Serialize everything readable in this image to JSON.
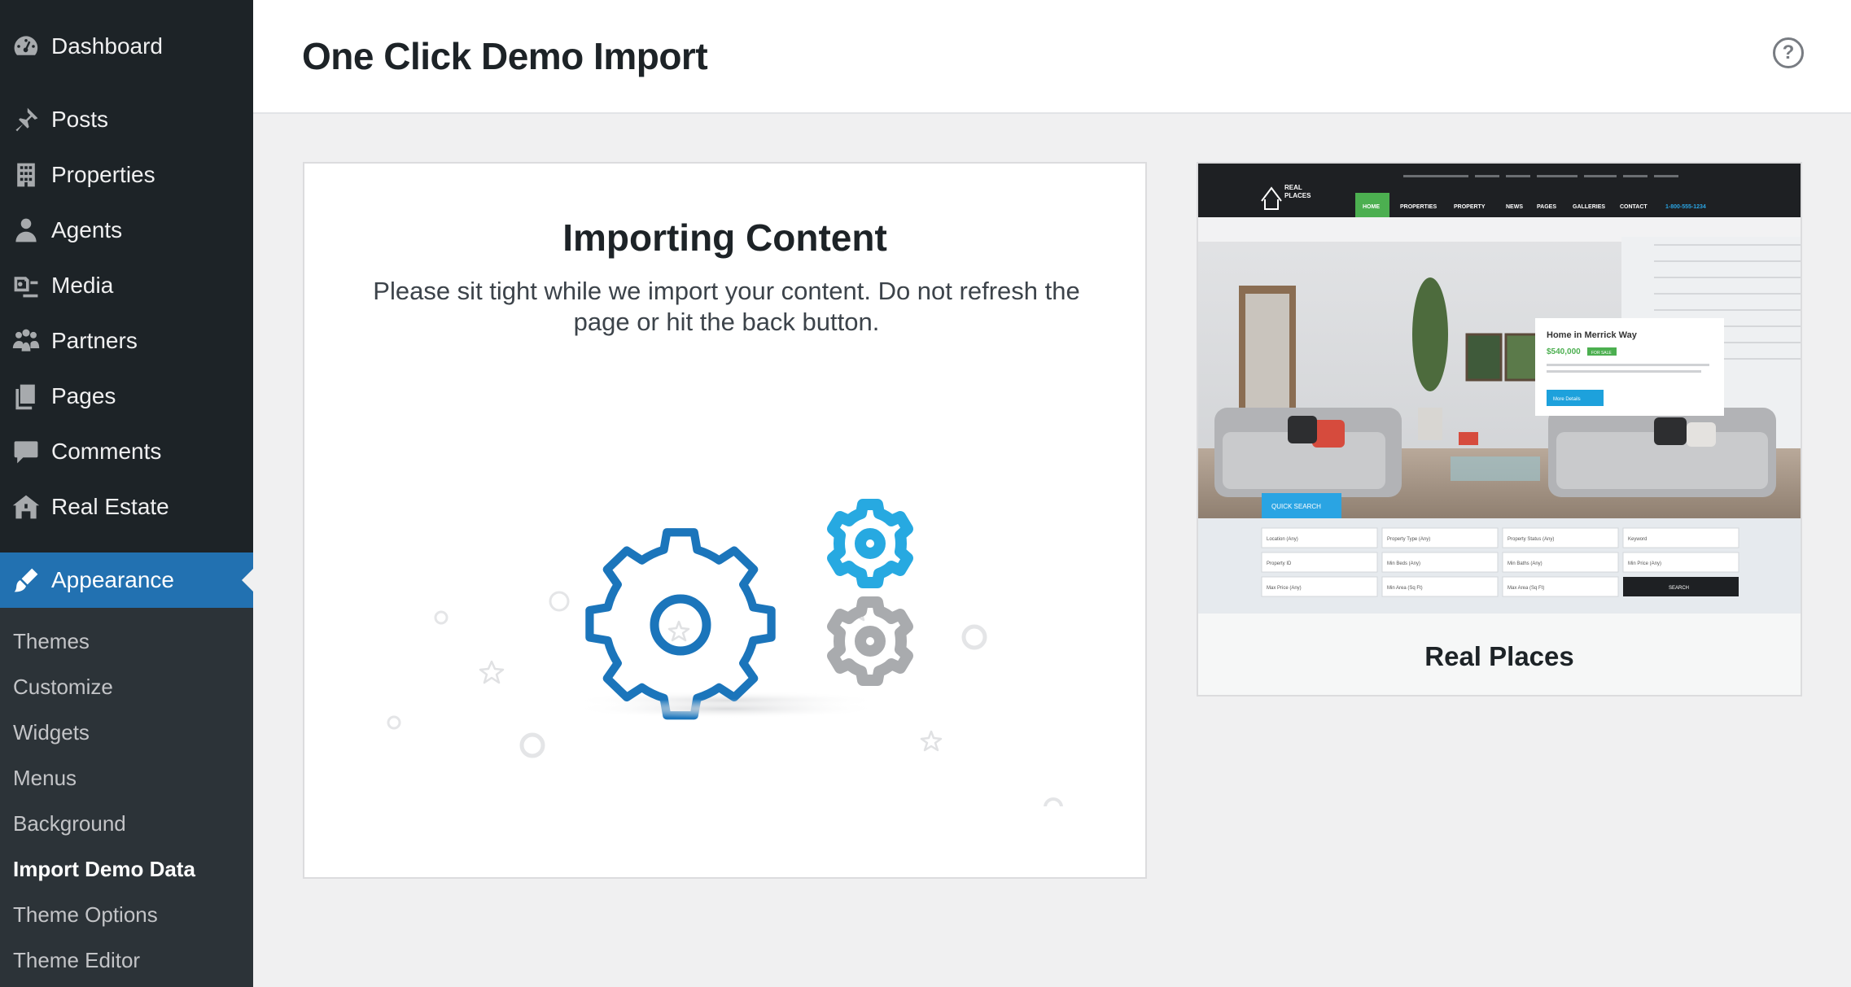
{
  "sidebar": {
    "items": [
      {
        "label": "Dashboard",
        "icon": "dashboard-icon"
      },
      {
        "label": "Posts",
        "icon": "pin-icon"
      },
      {
        "label": "Properties",
        "icon": "building-icon"
      },
      {
        "label": "Agents",
        "icon": "user-icon"
      },
      {
        "label": "Media",
        "icon": "media-icon"
      },
      {
        "label": "Partners",
        "icon": "groups-icon"
      },
      {
        "label": "Pages",
        "icon": "pages-icon"
      },
      {
        "label": "Comments",
        "icon": "comment-icon"
      },
      {
        "label": "Real Estate",
        "icon": "houses-icon"
      },
      {
        "label": "Appearance",
        "icon": "brush-icon"
      }
    ],
    "submenu": [
      "Themes",
      "Customize",
      "Widgets",
      "Menus",
      "Background",
      "Import Demo Data",
      "Theme Options",
      "Theme Editor"
    ],
    "current_submenu": "Import Demo Data",
    "accent": "#2271b1"
  },
  "header": {
    "title": "One Click Demo Import",
    "help_glyph": "?"
  },
  "import": {
    "title": "Importing Content",
    "description": "Please sit tight while we import your content. Do not refresh the page or hit the back button.",
    "gear_colors": {
      "primary": "#1b75bb",
      "secondary": "#27a9e1",
      "tertiary": "#a9abae"
    }
  },
  "demo": {
    "name": "Real Places",
    "preview": {
      "nav": [
        "HOME",
        "PROPERTIES",
        "PROPERTY",
        "NEWS",
        "PAGES",
        "GALLERIES",
        "CONTACT"
      ],
      "phone": "1-800-555-1234",
      "logo_line1": "REAL",
      "logo_line2": "PLACES",
      "listing_title": "Home in Merrick Way",
      "listing_price": "$540,000",
      "listing_badge": "FOR SALE",
      "listing_button": "More Details",
      "quick_search": "QUICK SEARCH",
      "fields": [
        "Location (Any)",
        "Property Type (Any)",
        "Property Status (Any)",
        "Keyword",
        "Property ID",
        "Min Beds (Any)",
        "Min Baths (Any)",
        "Min Price (Any)",
        "Max Price (Any)",
        "Min Area (Sq Ft)",
        "Max Area (Sq Ft)"
      ],
      "search_button": "SEARCH"
    }
  }
}
